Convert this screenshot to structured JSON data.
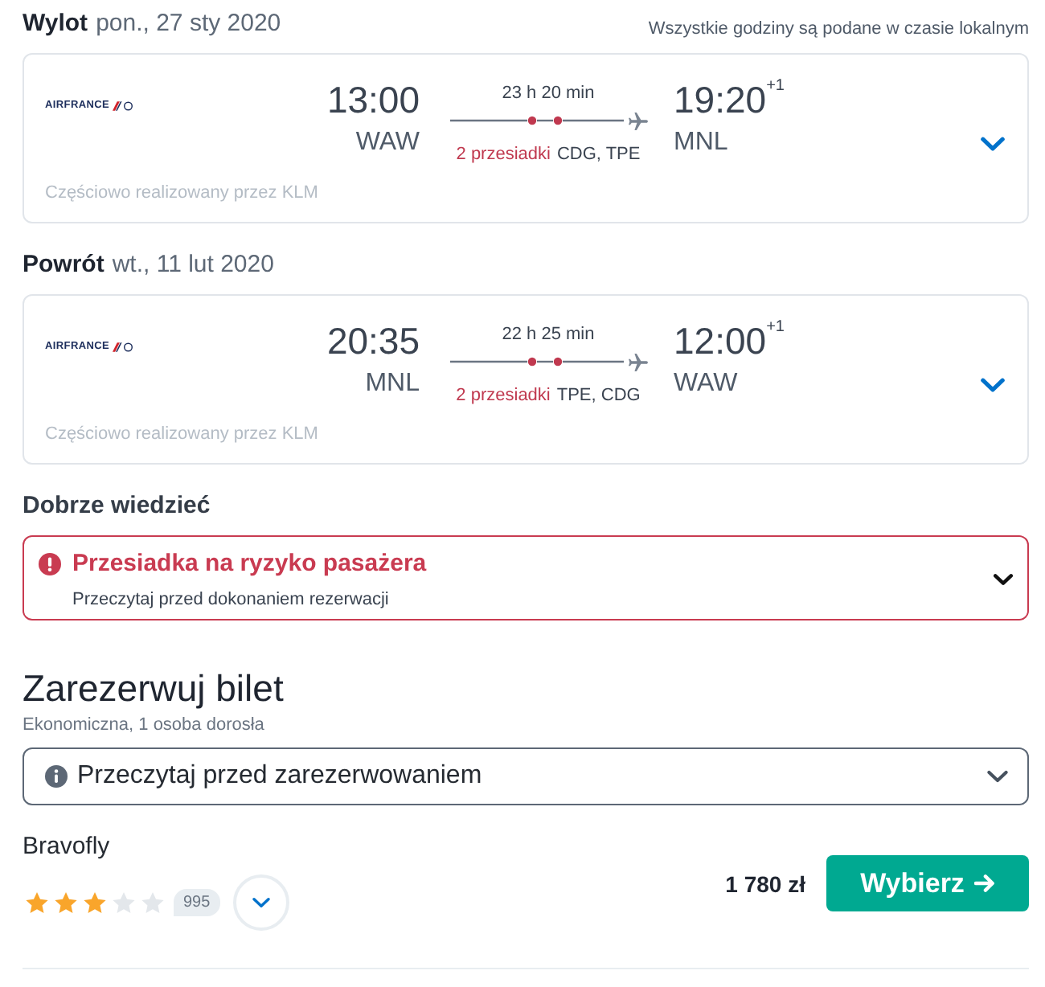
{
  "trips": [
    {
      "direction": "Wylot",
      "date": "pon., 27 sty 2020",
      "note": "Wszystkie godziny są podane w czasie lokalnym",
      "airline_logo": "AIRFRANCE",
      "departure_time": "13:00",
      "departure_airport": "WAW",
      "duration": "23 h 20 min",
      "stops": "2 przesiadki",
      "via": "CDG, TPE",
      "arrival_time": "19:20",
      "arrival_day_offset": "+1",
      "arrival_airport": "MNL",
      "operated_by": "Częściowo realizowany przez KLM",
      "expanded": false
    },
    {
      "direction": "Powrót",
      "date": "wt., 11 lut 2020",
      "airline_logo": "AIRFRANCE",
      "departure_time": "20:35",
      "departure_airport": "MNL",
      "duration": "22 h 25 min",
      "stops": "2 przesiadki",
      "via": "TPE, CDG",
      "arrival_time": "12:00",
      "arrival_day_offset": "+1",
      "arrival_airport": "WAW",
      "operated_by": "Częściowo realizowany przez KLM",
      "expanded": false
    }
  ],
  "notice": {
    "heading": "Dobrze wiedzieć",
    "title": "Przesiadka na ryzyko pasażera",
    "text": "Przeczytaj przed dokonaniem rezerwacji",
    "expanded": false
  },
  "booking": {
    "title": "Zarezerwuj bilet",
    "subtitle": "Ekonomiczna, 1 osoba dorosła",
    "info": {
      "label": "Przeczytaj przed zarezerwowaniem",
      "expanded": false
    },
    "offers": [
      {
        "provider": "Bravofly",
        "stars": 3,
        "reviews": "995",
        "expanded": false,
        "price": "1 780 zł",
        "button": "Wybierz"
      }
    ]
  }
}
